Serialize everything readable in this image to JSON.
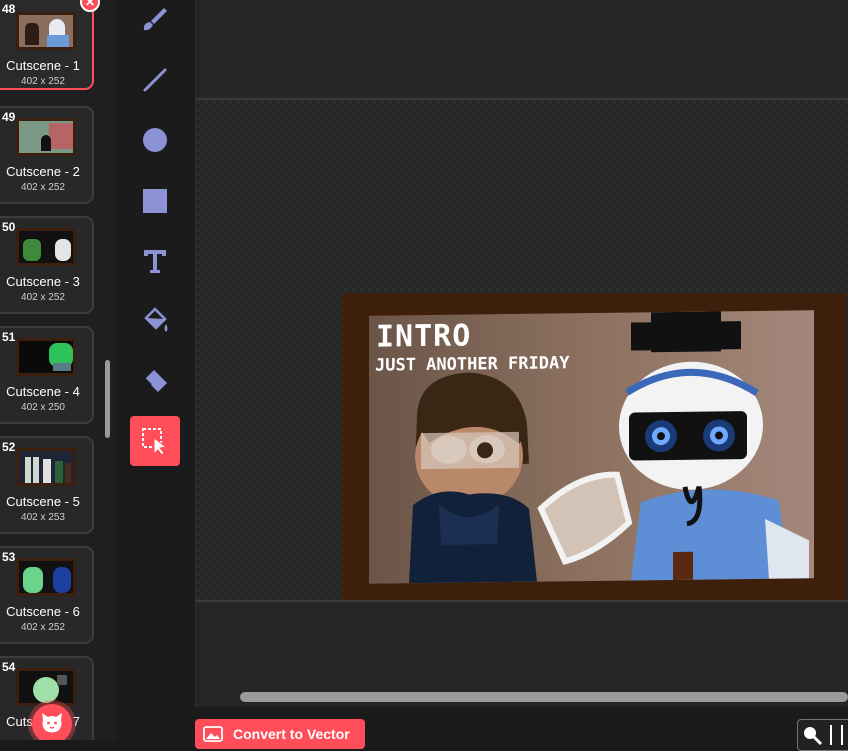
{
  "costumes": [
    {
      "num": "48",
      "name": "Cutscene - 1",
      "size": "402 x 252",
      "selected": true
    },
    {
      "num": "49",
      "name": "Cutscene - 2",
      "size": "402 x 252"
    },
    {
      "num": "50",
      "name": "Cutscene - 3",
      "size": "402 x 252"
    },
    {
      "num": "51",
      "name": "Cutscene - 4",
      "size": "402 x 250"
    },
    {
      "num": "52",
      "name": "Cutscene - 5",
      "size": "402 x 253"
    },
    {
      "num": "53",
      "name": "Cutscene - 6",
      "size": "402 x 252"
    },
    {
      "num": "54",
      "name": "Cutscene - 7",
      "size": ""
    }
  ],
  "tools": [
    "brush-icon",
    "line-icon",
    "circle-icon",
    "rectangle-icon",
    "text-icon",
    "fill-icon",
    "eraser-icon",
    "select-icon"
  ],
  "active_tool": "select-icon",
  "canvas": {
    "title": "INTRO",
    "subtitle": "JUST ANOTHER FRIDAY"
  },
  "bottom": {
    "convert_label": "Convert to Vector"
  },
  "colors": {
    "accent": "#ff4d5a",
    "tool_icon": "#8b93d6",
    "frame": "#3d1f0c"
  }
}
